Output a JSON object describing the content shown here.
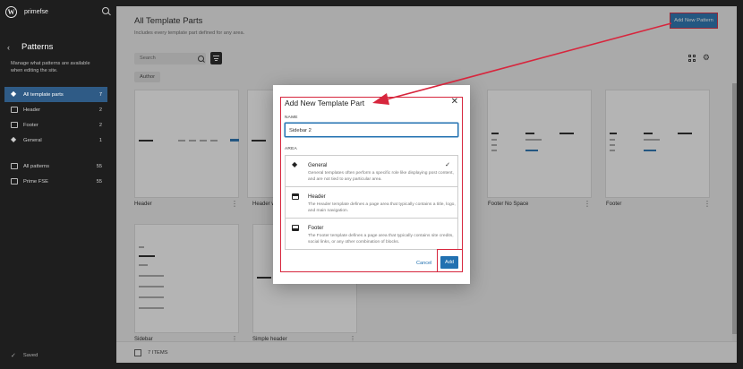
{
  "site": {
    "name": "primefse"
  },
  "sidebar": {
    "title": "Patterns",
    "description": "Manage what patterns are available when editing the site.",
    "items": [
      {
        "label": "All template parts",
        "count": "7"
      },
      {
        "label": "Header",
        "count": "2"
      },
      {
        "label": "Footer",
        "count": "2"
      },
      {
        "label": "General",
        "count": "1"
      },
      {
        "label": "All patterns",
        "count": "55"
      },
      {
        "label": "Prime FSE",
        "count": "55"
      }
    ],
    "saved": "Saved"
  },
  "main": {
    "title": "All Template Parts",
    "subtitle": "Includes every template part defined for any area.",
    "add_button": "Add New Pattern",
    "search_placeholder": "Search",
    "author_filter": "Author",
    "cards": [
      {
        "label": "Header"
      },
      {
        "label": "Header w"
      },
      {
        "label": "Footer No Space"
      },
      {
        "label": "Footer"
      },
      {
        "label": "Sidebar"
      },
      {
        "label": "Simple header"
      }
    ],
    "items_count": "7 ITEMS"
  },
  "modal": {
    "title": "Add New Template Part",
    "name_label": "NAME",
    "name_value": "Sidebar 2",
    "area_label": "AREA",
    "areas": [
      {
        "name": "General",
        "desc": "General templates often perform a specific role like displaying post content, and are not tied to any particular area."
      },
      {
        "name": "Header",
        "desc": "The Header template defines a page area that typically contains a title, logo, and main navigation."
      },
      {
        "name": "Footer",
        "desc": "The Footer template defines a page area that typically contains site credits, social links, or any other combination of blocks."
      }
    ],
    "cancel": "Cancel",
    "add": "Add"
  },
  "colors": {
    "accent": "#2271b1",
    "annotation": "#d7263d",
    "sidebar_bg": "#1e1e1e"
  }
}
